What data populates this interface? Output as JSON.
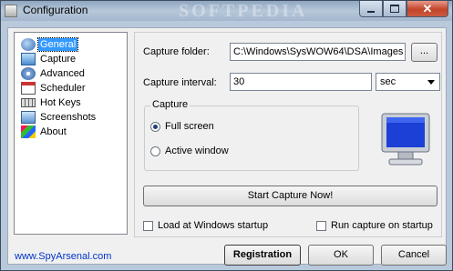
{
  "window": {
    "title": "Configuration",
    "watermark": "SOFTPEDIA",
    "close_glyph": "✕"
  },
  "sidebar": {
    "items": [
      {
        "label": "General",
        "icon": "general-icon",
        "selected": true
      },
      {
        "label": "Capture",
        "icon": "capture-icon"
      },
      {
        "label": "Advanced",
        "icon": "advanced-icon"
      },
      {
        "label": "Scheduler",
        "icon": "scheduler-icon"
      },
      {
        "label": "Hot Keys",
        "icon": "hotkeys-icon"
      },
      {
        "label": "Screenshots",
        "icon": "screenshots-icon"
      },
      {
        "label": "About",
        "icon": "about-icon"
      }
    ],
    "site_link": "www.SpyArsenal.com"
  },
  "general": {
    "capture_folder_label": "Capture folder:",
    "capture_folder_value": "C:\\Windows\\SysWOW64\\DSA\\Images",
    "browse_label": "...",
    "capture_interval_label": "Capture interval:",
    "capture_interval_value": "30",
    "interval_unit": "sec",
    "capture_group_label": "Capture",
    "full_screen_label": "Full screen",
    "active_window_label": "Active window",
    "selected_mode": "Full screen",
    "start_capture_label": "Start Capture Now!",
    "load_startup_label": "Load at Windows startup",
    "run_on_startup_label": "Run capture on startup"
  },
  "footer": {
    "registration_label": "Registration",
    "ok_label": "OK",
    "cancel_label": "Cancel"
  }
}
